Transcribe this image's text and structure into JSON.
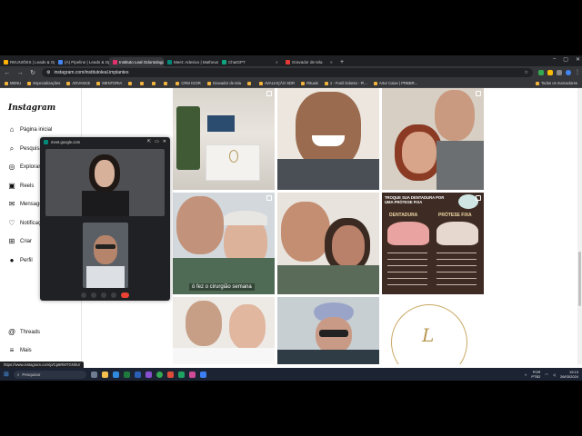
{
  "browser": {
    "tabs": [
      {
        "label": "REUNIÕES | Leads & Oper...",
        "color": "#ffb000"
      },
      {
        "label": "(A) Pipeline | Leads & Oper...",
        "color": "#4285f4"
      },
      {
        "label": "Instituto Leal Odontologia - In...",
        "color": "#e1306c"
      },
      {
        "label": "Meet: Adesivo | Matheus...",
        "color": "#00897b"
      },
      {
        "label": "ChatGPT",
        "color": "#10a37f"
      },
      {
        "label": "Gravador de tela",
        "color": "#e53935"
      }
    ],
    "new_tab": "+",
    "url": "instagram.com/institutoleal.implantes",
    "bookmarks": [
      "MENU",
      "Especializações",
      "ADVANCE",
      "MENTORIA",
      "",
      "",
      "",
      "",
      "CRM IGOR",
      "Gravador de tela",
      "",
      "AVALIAÇÃO SDR",
      "Rituais",
      "1 - Funil Odonto - Pi...",
      "Artur Caixe | PRBBR..."
    ],
    "bookmarks_right": "Todos os marcadores"
  },
  "instagram": {
    "logo": "Instagram",
    "nav": [
      {
        "label": "Página inicial",
        "icon": "home-icon",
        "glyph": "⌂"
      },
      {
        "label": "Pesquisar",
        "icon": "search-icon",
        "glyph": "⌕"
      },
      {
        "label": "Explorar",
        "icon": "compass-icon",
        "glyph": "◎"
      },
      {
        "label": "Reels",
        "icon": "reels-icon",
        "glyph": "▣"
      },
      {
        "label": "Mensagens",
        "icon": "messenger-icon",
        "glyph": "✉"
      },
      {
        "label": "Notificações",
        "icon": "heart-icon",
        "glyph": "♡"
      },
      {
        "label": "Criar",
        "icon": "create-icon",
        "glyph": "⊞"
      },
      {
        "label": "Perfil",
        "icon": "profile-icon",
        "glyph": "●"
      }
    ],
    "threads_label": "Threads",
    "more_label": "Mais",
    "posts": {
      "caption_overlay": "ó fez o cirurgião semana",
      "promo_title": "TROQUE SUA DENTADURA POR UMA PRÓTESE FIXA",
      "promo_left": "DENTADURA",
      "promo_right": "PRÓTESE FIXA"
    }
  },
  "meet": {
    "url": "meet.google.com"
  },
  "status_url": "https://www.instagram.com/p/Cp6RMTGNhU/",
  "taskbar": {
    "search_placeholder": "Pesquisar",
    "lang": "POR",
    "layout": "PTB2",
    "time": "19:13",
    "date": "26/03/2024"
  }
}
